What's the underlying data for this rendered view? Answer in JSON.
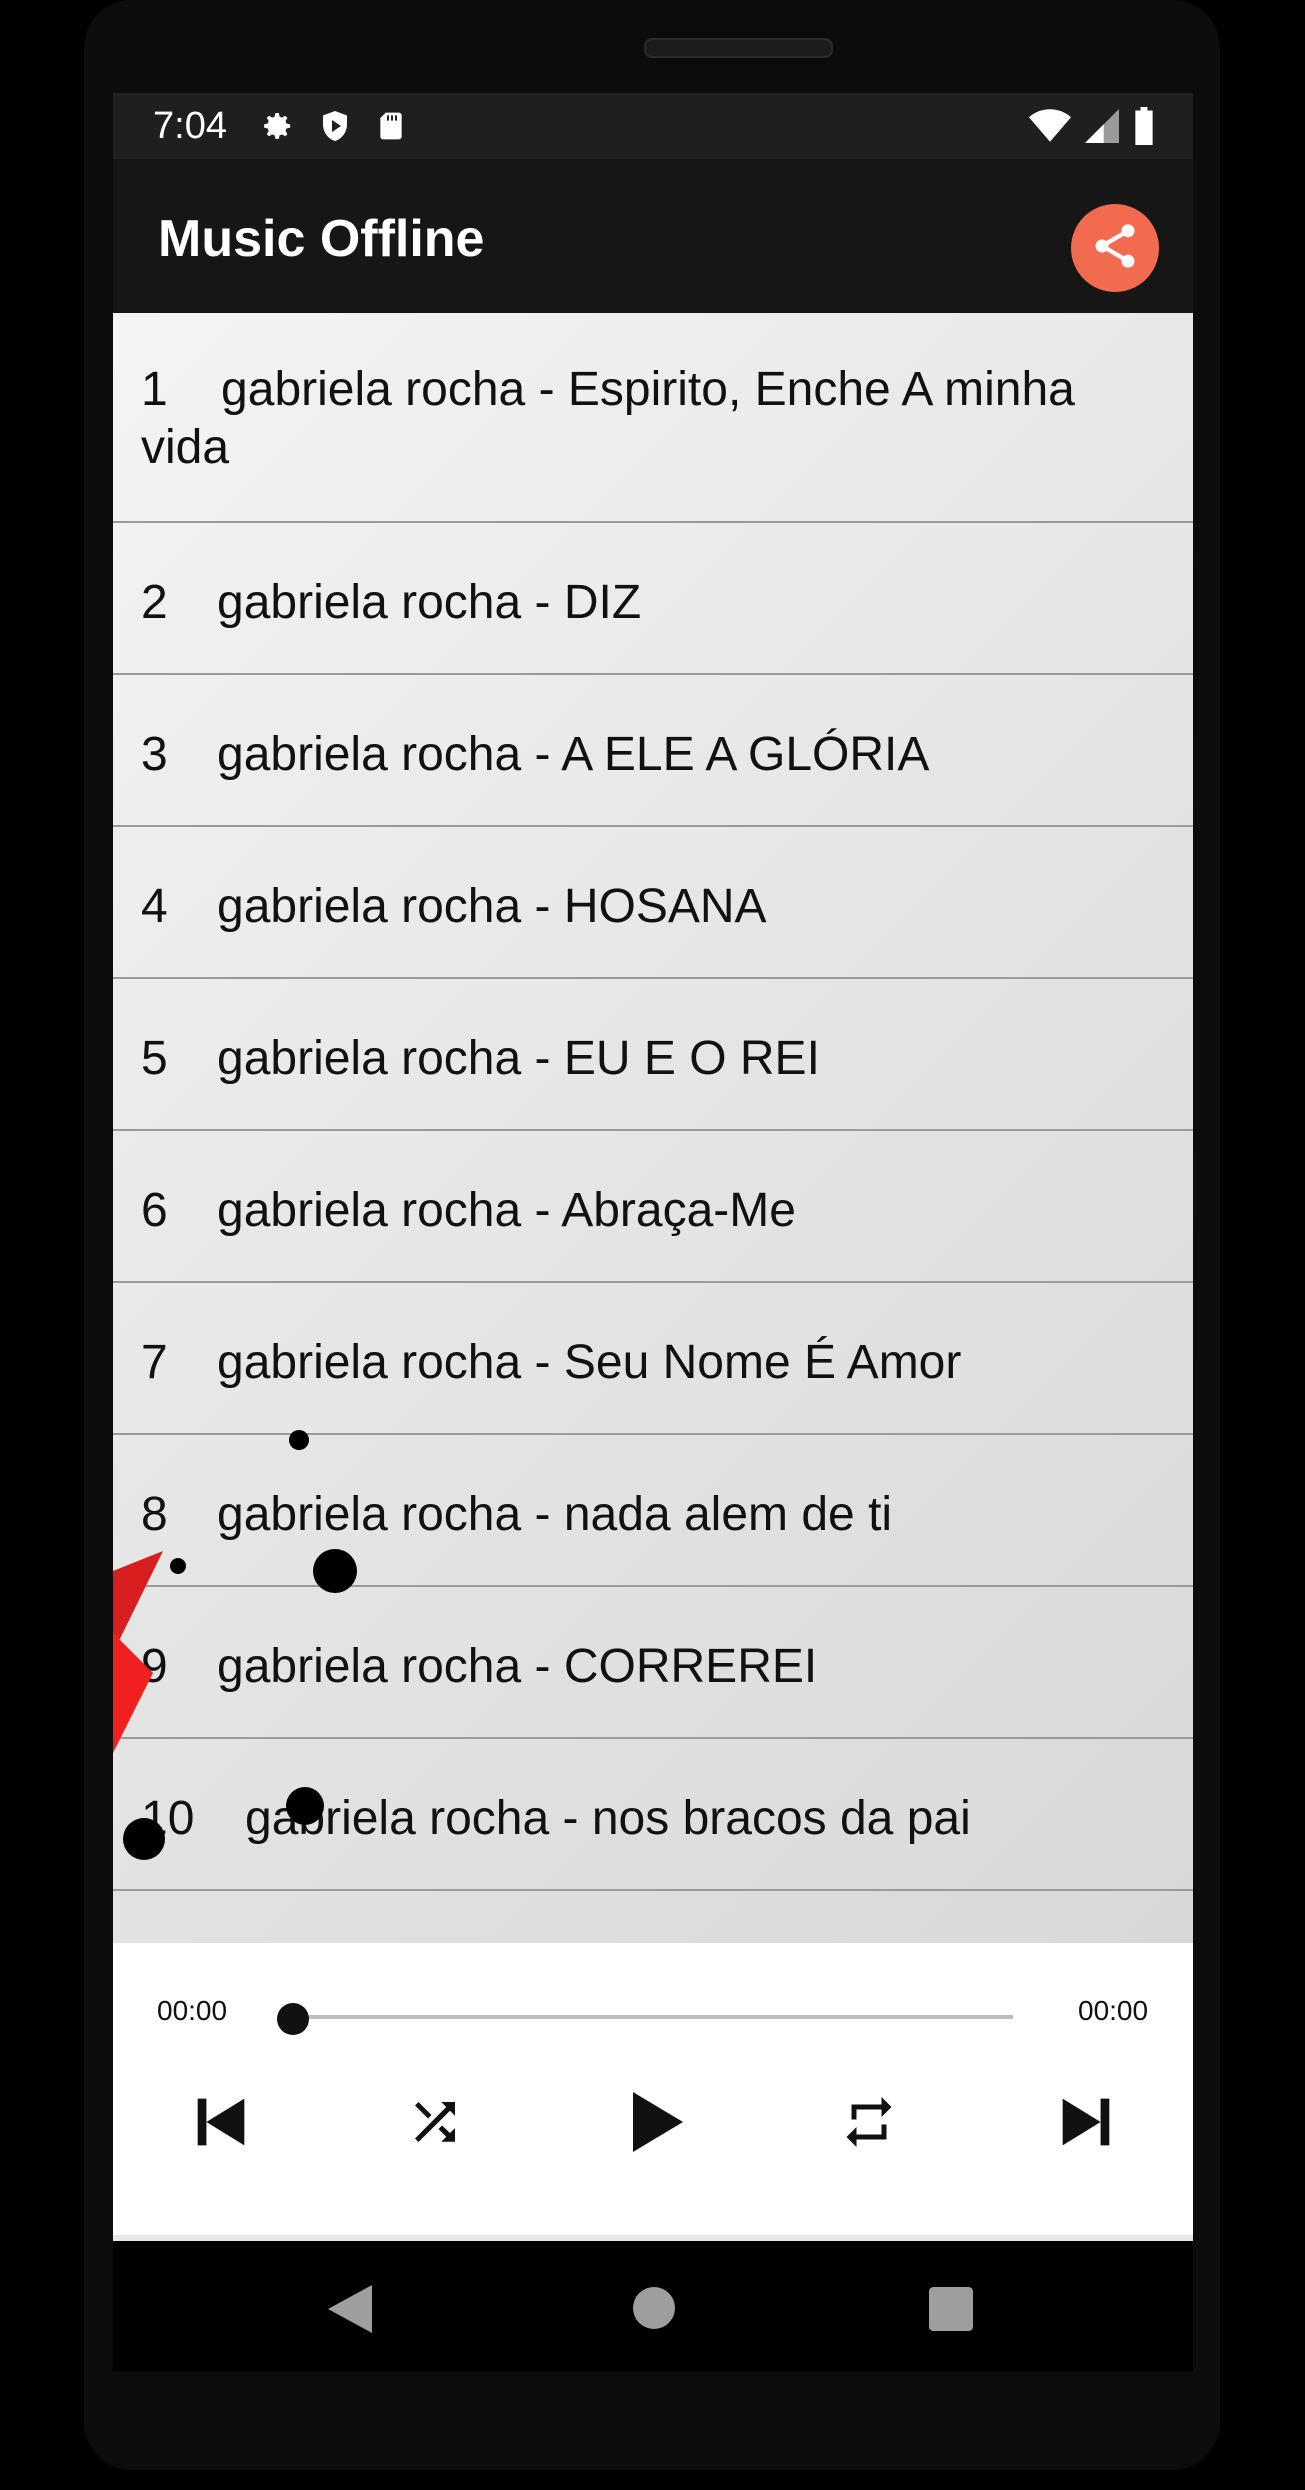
{
  "status_bar": {
    "time": "7:04",
    "icons_left": [
      "settings-icon",
      "shield-play-icon",
      "sd-card-icon"
    ],
    "icons_right": [
      "wifi-icon",
      "cell-signal-icon",
      "battery-icon"
    ]
  },
  "app_bar": {
    "title": "Music Offline",
    "share_icon": "share-icon",
    "share_color": "#f26b4f"
  },
  "tracks": [
    {
      "num": "1",
      "title": "gabriela rocha - Espirito, Enche A minha vida"
    },
    {
      "num": "2",
      "title": "gabriela rocha - DIZ"
    },
    {
      "num": "3",
      "title": "gabriela rocha - A ELE A GLÓRIA"
    },
    {
      "num": "4",
      "title": "gabriela rocha - HOSANA"
    },
    {
      "num": "5",
      "title": "gabriela rocha - EU E O REI"
    },
    {
      "num": "6",
      "title": "gabriela rocha - Abraça-Me"
    },
    {
      "num": "7",
      "title": "gabriela rocha - Seu Nome É Amor"
    },
    {
      "num": "8",
      "title": "gabriela rocha - nada alem de ti"
    },
    {
      "num": "9",
      "title": "gabriela rocha - CORREREI"
    },
    {
      "num": "10",
      "title": "gabriela rocha - nos bracos da pai"
    }
  ],
  "player": {
    "elapsed": "00:00",
    "duration": "00:00",
    "progress": 0,
    "controls": [
      "skip-previous-icon",
      "shuffle-icon",
      "play-icon",
      "repeat-icon",
      "skip-next-icon"
    ]
  },
  "nav_bar": [
    "back-icon",
    "home-icon",
    "recents-icon"
  ]
}
